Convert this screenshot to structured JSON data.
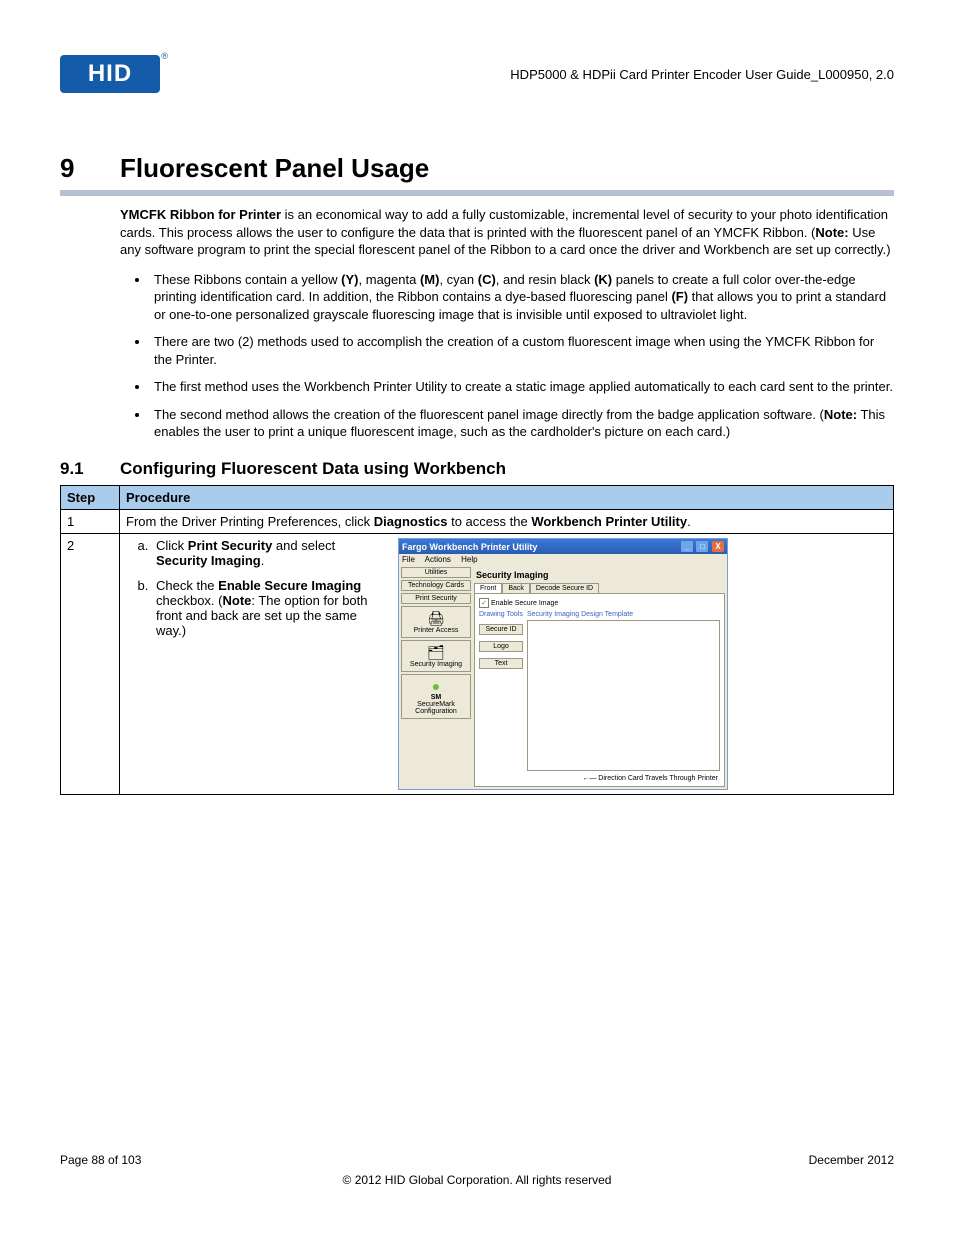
{
  "header": {
    "logo_text": "HID",
    "doc_title": "HDP5000 & HDPii Card Printer Encoder User Guide_L000950, 2.0"
  },
  "chapter": {
    "number": "9",
    "title": "Fluorescent Panel Usage"
  },
  "intro": {
    "lead_bold": "YMCFK Ribbon for Printer",
    "lead_rest_1": " is an economical way to add a fully customizable, incremental level of security to your photo identification cards. This process allows the user to configure the data that is printed with the fluorescent panel of an YMCFK Ribbon. (",
    "note_label": "Note:",
    "lead_rest_2": "  Use any software program to print the special florescent panel of the Ribbon to a card once the driver and Workbench are set up correctly.)"
  },
  "bullets": {
    "b1a": "These Ribbons contain a yellow ",
    "b1y": "(Y)",
    "b1b": ", magenta ",
    "b1m": "(M)",
    "b1c": ", cyan ",
    "b1cy": "(C)",
    "b1d": ", and resin black ",
    "b1k": "(K)",
    "b1e": " panels to create a full color over-the-edge printing identification card. In addition, the Ribbon contains a dye-based fluorescing panel ",
    "b1f": "(F)",
    "b1g": " that allows you to print a standard or one-to-one personalized grayscale fluorescing image that is invisible until exposed to ultraviolet light.",
    "b2": "There are two (2) methods used to accomplish the creation of a custom fluorescent image when using the YMCFK Ribbon for the Printer.",
    "b3": "The first method uses the Workbench Printer Utility to create a static image applied automatically to each card sent to the printer.",
    "b4a": "The second method allows the creation of the fluorescent panel image directly from the badge application software. (",
    "b4note": "Note:",
    "b4b": "  This enables the user to print a unique fluorescent image, such as the cardholder's picture on each card.)"
  },
  "sub": {
    "number": "9.1",
    "title": "Configuring Fluorescent Data using Workbench"
  },
  "table": {
    "h_step": "Step",
    "h_proc": "Procedure",
    "r1_step": "1",
    "r1_a": "From the Driver Printing Preferences, click ",
    "r1_b": "Diagnostics",
    "r1_c": " to access the ",
    "r1_d": "Workbench Printer Utility",
    "r1_e": ".",
    "r2_step": "2",
    "r2_a1": "Click ",
    "r2_a2": "Print Security",
    "r2_a3": " and select ",
    "r2_a4": "Security Imaging",
    "r2_a5": ".",
    "r2_b1": "Check the ",
    "r2_b2": "Enable Secure Imaging",
    "r2_b3": " checkbox. (",
    "r2_b4": "Note",
    "r2_b5": ": The option for both front and back are set up the same way.)"
  },
  "shot": {
    "title": "Fargo Workbench Printer Utility",
    "menu_file": "File",
    "menu_actions": "Actions",
    "menu_help": "Help",
    "side_utilities": "Utilities",
    "side_tech": "Technology Cards",
    "side_printsec": "Print Security",
    "side_printer_access": "Printer Access",
    "side_sec_img": "Security Imaging",
    "side_sm": "SM",
    "side_smconf": "SecureMark Configuration",
    "main_title": "Security Imaging",
    "tab_front": "Front",
    "tab_back": "Back",
    "tab_decode": "Decode Secure ID",
    "chk_label": "Enable Secure Image",
    "tools_label": "Drawing Tools",
    "tmpl_label": "Security Imaging Design Template",
    "btn_secureid": "Secure ID",
    "btn_logo": "Logo",
    "btn_text": "Text",
    "travel": "Direction Card Travels Through Printer",
    "arrow": "←—"
  },
  "footer": {
    "page": "Page 88 of 103",
    "date": "December 2012",
    "copy": "© 2012 HID Global Corporation. All rights reserved"
  }
}
